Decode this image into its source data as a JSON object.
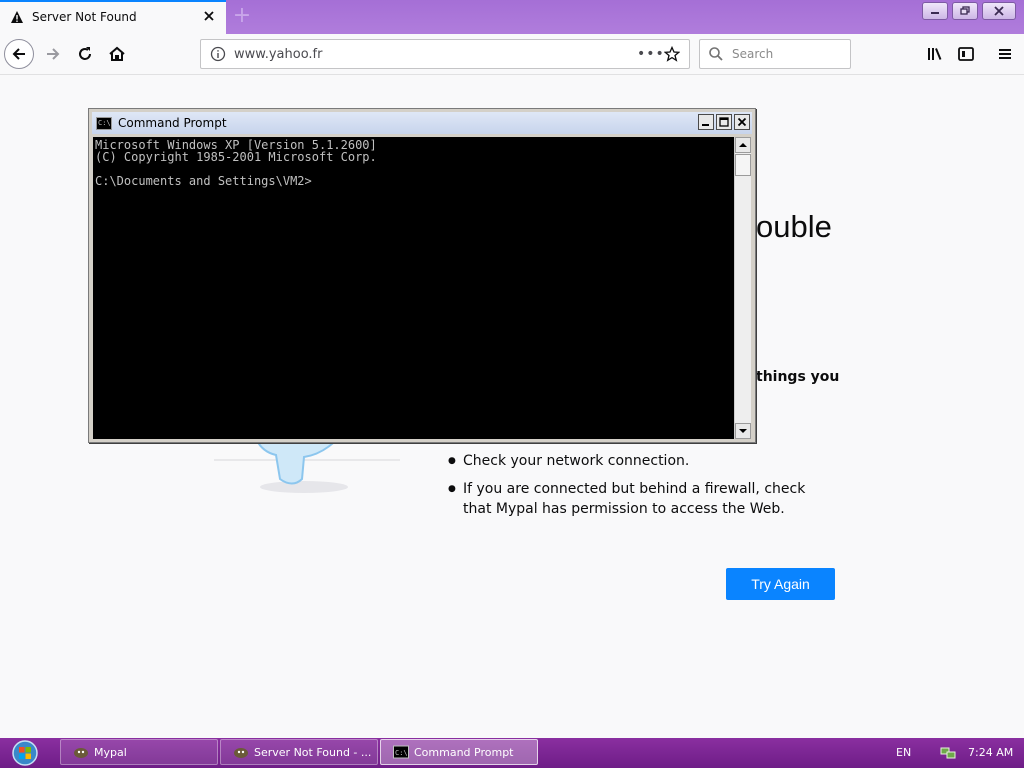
{
  "browser": {
    "tab_title": "Server Not Found",
    "new_tab_symbol": "+",
    "url": "www.yahoo.fr",
    "page_actions": "•••",
    "search_placeholder": "Search"
  },
  "page": {
    "title_fragment": "ouble",
    "description_fragment": "things you",
    "bullets": [
      "Check your network connection.",
      "If you are connected but behind a firewall, check that Mypal has permission to access the Web."
    ],
    "try_again_label": "Try Again"
  },
  "cmd": {
    "title": "Command Prompt",
    "icon_text": "C:\\",
    "lines": [
      "Microsoft Windows XP [Version 5.1.2600]",
      "(C) Copyright 1985-2001 Microsoft Corp.",
      "",
      "C:\\Documents and Settings\\VM2>"
    ]
  },
  "taskbar": {
    "items": [
      {
        "label": "Mypal",
        "active": false
      },
      {
        "label": "Server Not Found - ...",
        "active": false
      },
      {
        "label": "Command Prompt",
        "active": true
      }
    ],
    "language": "EN",
    "clock": "7:24 AM"
  },
  "colors": {
    "tabstrip": "#a56fd6",
    "accent_blue": "#0a84ff",
    "taskbar": "#7a2592",
    "console_bg": "#000000",
    "console_fg": "#c0c0c0"
  }
}
